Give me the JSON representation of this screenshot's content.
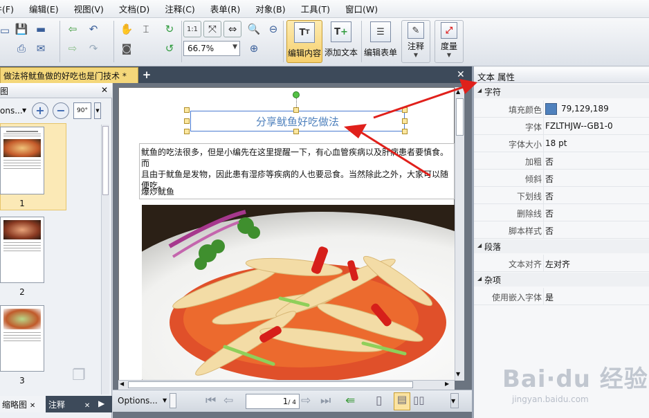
{
  "menu": [
    "文件(F)",
    "编辑(E)",
    "视图(V)",
    "文档(D)",
    "注释(C)",
    "表单(R)",
    "对象(B)",
    "工具(T)",
    "窗口(W)"
  ],
  "toolbar": {
    "zoom_value": "66.7%",
    "edit_content": "编辑内容",
    "add_text": "添加文本",
    "edit_form": "编辑表单",
    "annotate": "注释",
    "measure": "度量",
    "rotate_label": "90°"
  },
  "tab": {
    "title": "做法将鱿鱼做的好吃也是门技术 *"
  },
  "left_panel": {
    "header": "图",
    "options": "ons...",
    "thumb_numbers": [
      "1",
      "2",
      "3"
    ],
    "tab_thumbs": "缩略图",
    "tab_notes": "注释"
  },
  "document": {
    "title": "分享鱿鱼好吃做法",
    "paragraph": "鱿鱼的吃法很多，但是小编先在这里提醒一下，有心血管疾病以及肝病患者要慎食。而\n且由于鱿鱼是发物，因此患有湿疹等疾病的人也要忌食。当然除此之外，大家可以随\n便吃。",
    "subheading": "爆炒鱿鱼"
  },
  "statusbar": {
    "options": "Options...",
    "page_input": "1",
    "page_total": "/ 4"
  },
  "properties": {
    "title": "文本 属性",
    "sections": {
      "char": "字符",
      "para": "段落",
      "misc": "杂项"
    },
    "rows": [
      {
        "key": "填充颜色",
        "value": "79,129,189"
      },
      {
        "key": "字体",
        "value": "FZLTHJW--GB1-0"
      },
      {
        "key": "字体大小",
        "value": "18 pt"
      },
      {
        "key": "加粗",
        "value": "否"
      },
      {
        "key": "倾斜",
        "value": "否"
      },
      {
        "key": "下划线",
        "value": "否"
      },
      {
        "key": "删除线",
        "value": "否"
      },
      {
        "key": "脚本样式",
        "value": "否"
      },
      {
        "key": "文本对齐",
        "value": "左对齐"
      },
      {
        "key": "使用嵌入字体",
        "value": "是"
      }
    ]
  },
  "watermark": {
    "brand": "Bai·du 经验",
    "url": "jingyan.baidu.com"
  },
  "colors": {
    "fill": "#4f81bd",
    "accent_tab": "#f4d77a",
    "arrow": "#e0201b"
  }
}
